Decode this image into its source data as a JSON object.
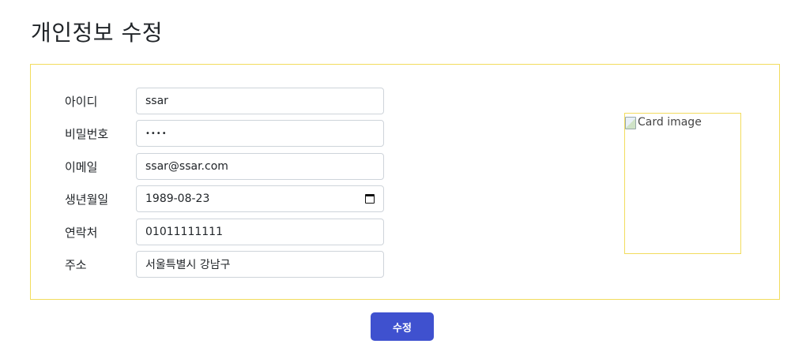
{
  "page": {
    "title": "개인정보 수정"
  },
  "form": {
    "username": {
      "label": "아이디",
      "value": "ssar"
    },
    "password": {
      "label": "비밀번호",
      "value": "••••"
    },
    "email": {
      "label": "이메일",
      "value": "ssar@ssar.com"
    },
    "birthdate": {
      "label": "생년월일",
      "value": "1989-08-23"
    },
    "phone": {
      "label": "연락처",
      "value": "01011111111"
    },
    "address": {
      "label": "주소",
      "value": "서울특별시 강남구"
    }
  },
  "profile_image": {
    "alt": "Card image"
  },
  "actions": {
    "submit_label": "수정"
  },
  "colors": {
    "card_border": "#f2dc5d",
    "button_bg": "#3f51cf",
    "input_border": "#ced4da"
  },
  "icons": {
    "date_field": "calendar-icon",
    "image": "broken-image-icon"
  }
}
